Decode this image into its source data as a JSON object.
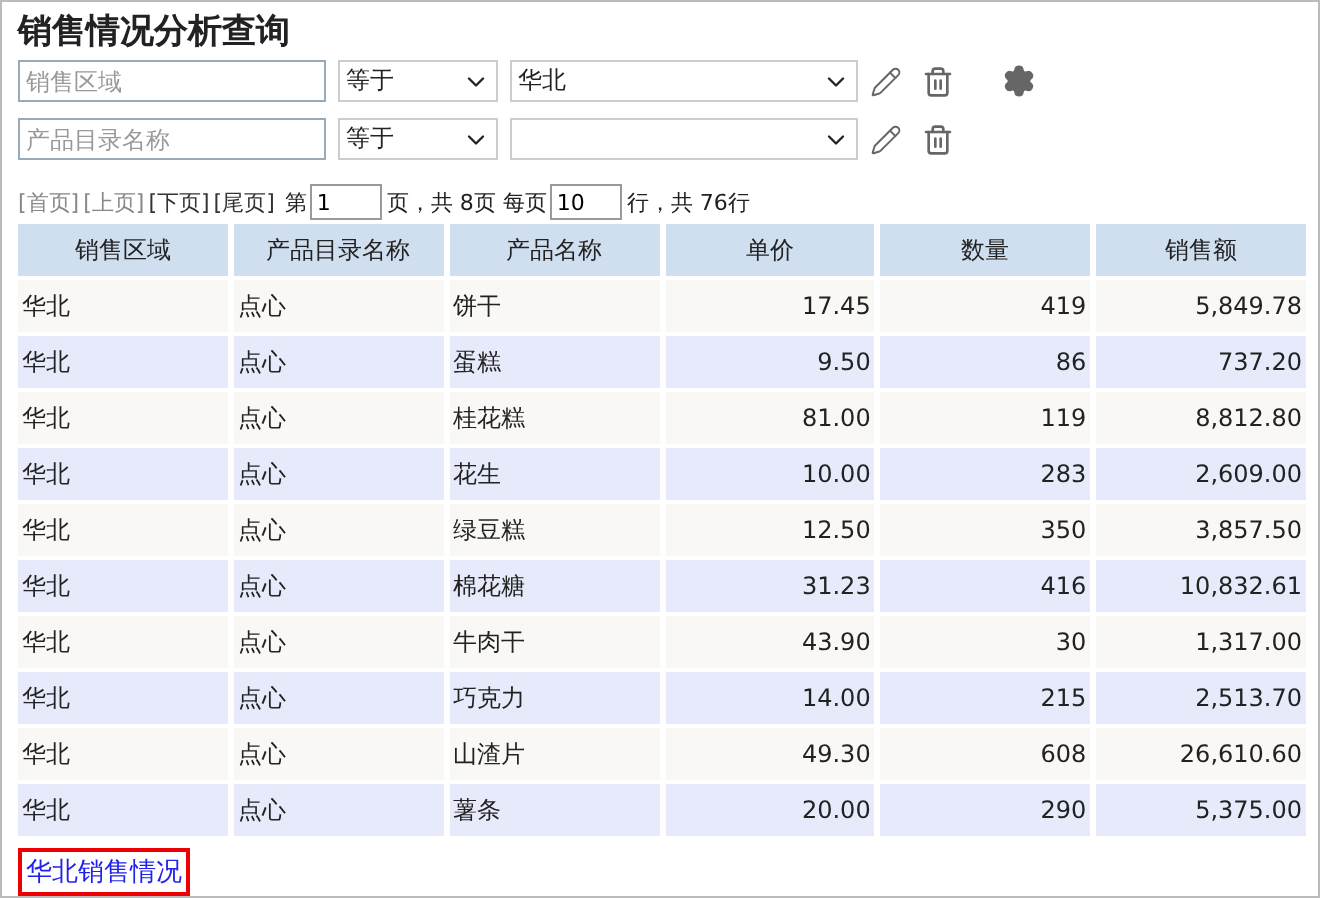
{
  "title": "销售情况分析查询",
  "filters": [
    {
      "placeholder": "销售区域",
      "operator": "等于",
      "value": "华北"
    },
    {
      "placeholder": "产品目录名称",
      "operator": "等于"
    }
  ],
  "pager": {
    "links": [
      {
        "label": "[首页]",
        "disabled": true
      },
      {
        "label": "[上页]",
        "disabled": true
      },
      {
        "label": "[下页]",
        "disabled": false
      },
      {
        "label": "[尾页]",
        "disabled": false
      }
    ],
    "page_prefix": "第",
    "page": "1",
    "page_suffix": "页，共 8页 每页",
    "rows_per_page": "10",
    "rows_suffix": "行，共 76行"
  },
  "table": {
    "columns": [
      {
        "label": "销售区域",
        "kind": "text"
      },
      {
        "label": "产品目录名称",
        "kind": "text"
      },
      {
        "label": "产品名称",
        "kind": "text"
      },
      {
        "label": "单价",
        "kind": "number"
      },
      {
        "label": "数量",
        "kind": "number"
      },
      {
        "label": "销售额",
        "kind": "number"
      }
    ],
    "rows": [
      [
        "华北",
        "点心",
        "饼干",
        "17.45",
        "419",
        "5,849.78"
      ],
      [
        "华北",
        "点心",
        "蛋糕",
        "9.50",
        "86",
        "737.20"
      ],
      [
        "华北",
        "点心",
        "桂花糕",
        "81.00",
        "119",
        "8,812.80"
      ],
      [
        "华北",
        "点心",
        "花生",
        "10.00",
        "283",
        "2,609.00"
      ],
      [
        "华北",
        "点心",
        "绿豆糕",
        "12.50",
        "350",
        "3,857.50"
      ],
      [
        "华北",
        "点心",
        "棉花糖",
        "31.23",
        "416",
        "10,832.61"
      ],
      [
        "华北",
        "点心",
        "牛肉干",
        "43.90",
        "30",
        "1,317.00"
      ],
      [
        "华北",
        "点心",
        "巧克力",
        "14.00",
        "215",
        "2,513.70"
      ],
      [
        "华北",
        "点心",
        "山渣片",
        "49.30",
        "608",
        "26,610.60"
      ],
      [
        "华北",
        "点心",
        "薯条",
        "20.00",
        "290",
        "5,375.00"
      ]
    ]
  },
  "footer_link": "华北销售情况"
}
